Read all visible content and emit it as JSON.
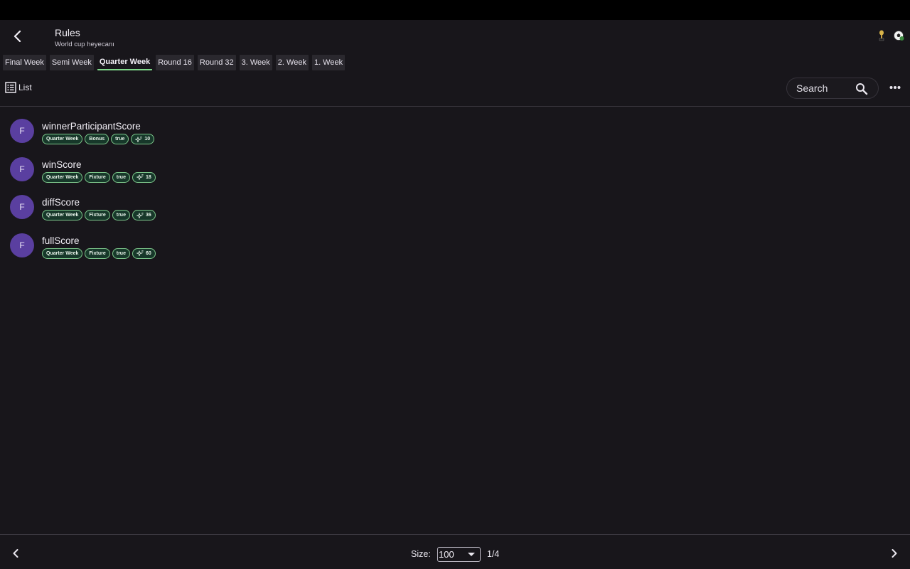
{
  "app": {
    "title": "Rules",
    "subtitle": "World cup heyecanı"
  },
  "tabs": [
    {
      "label": "Final Week",
      "active": false
    },
    {
      "label": "Semi Week",
      "active": false
    },
    {
      "label": "Quarter Week",
      "active": true
    },
    {
      "label": "Round 16",
      "active": false
    },
    {
      "label": "Round 32",
      "active": false
    },
    {
      "label": "3. Week",
      "active": false
    },
    {
      "label": "2. Week",
      "active": false
    },
    {
      "label": "1. Week",
      "active": false
    }
  ],
  "view": {
    "list_label": "List",
    "search_placeholder": "Search"
  },
  "rules": [
    {
      "avatar": "F",
      "name": "winnerParticipantScore",
      "week": "Quarter Week",
      "type": "Bonus",
      "enabled": "true",
      "points": "10"
    },
    {
      "avatar": "F",
      "name": "winScore",
      "week": "Quarter Week",
      "type": "Fixture",
      "enabled": "true",
      "points": "18"
    },
    {
      "avatar": "F",
      "name": "diffScore",
      "week": "Quarter Week",
      "type": "Fixture",
      "enabled": "true",
      "points": "36"
    },
    {
      "avatar": "F",
      "name": "fullScore",
      "week": "Quarter Week",
      "type": "Fixture",
      "enabled": "true",
      "points": "60"
    }
  ],
  "pagination": {
    "size_label": "Size:",
    "size_value": "100",
    "page_indicator": "1/4"
  },
  "colors": {
    "background": "#18161b",
    "accent": "#7fd88a",
    "avatar": "#5a3fa0",
    "chip_bg": "#17382a",
    "chip_border": "#7ec88c"
  }
}
